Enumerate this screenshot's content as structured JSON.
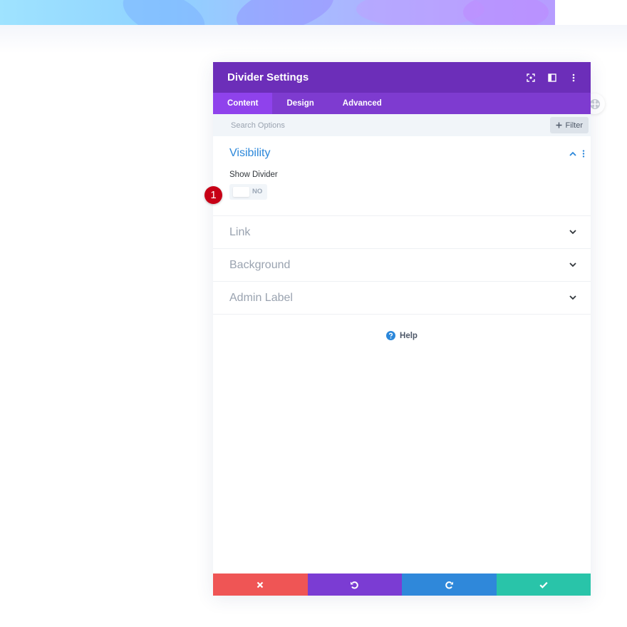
{
  "modal": {
    "title": "Divider Settings"
  },
  "tabs": [
    {
      "label": "Content",
      "active": true
    },
    {
      "label": "Design",
      "active": false
    },
    {
      "label": "Advanced",
      "active": false
    }
  ],
  "search": {
    "placeholder": "Search Options",
    "filter_label": "Filter"
  },
  "sections": {
    "visibility": {
      "title": "Visibility",
      "field_label": "Show Divider",
      "toggle_value": "NO"
    },
    "link": {
      "title": "Link"
    },
    "background": {
      "title": "Background"
    },
    "admin_label": {
      "title": "Admin Label"
    }
  },
  "marker": {
    "number": "1"
  },
  "help": {
    "label": "Help"
  },
  "colors": {
    "header": "#6c2eb9",
    "tabs": "#7e3bd0",
    "active_tab": "#8f42ec",
    "accent_blue": "#2b87da",
    "cancel": "#ef5555",
    "undo": "#7b3cd3",
    "redo": "#2f88da",
    "save": "#29c4a9",
    "marker": "#c70016"
  },
  "icons": {
    "header": [
      "fullscreen-icon",
      "split-view-icon",
      "more-vertical-icon"
    ],
    "footer": [
      "close-icon",
      "undo-icon",
      "redo-icon",
      "check-icon"
    ]
  }
}
